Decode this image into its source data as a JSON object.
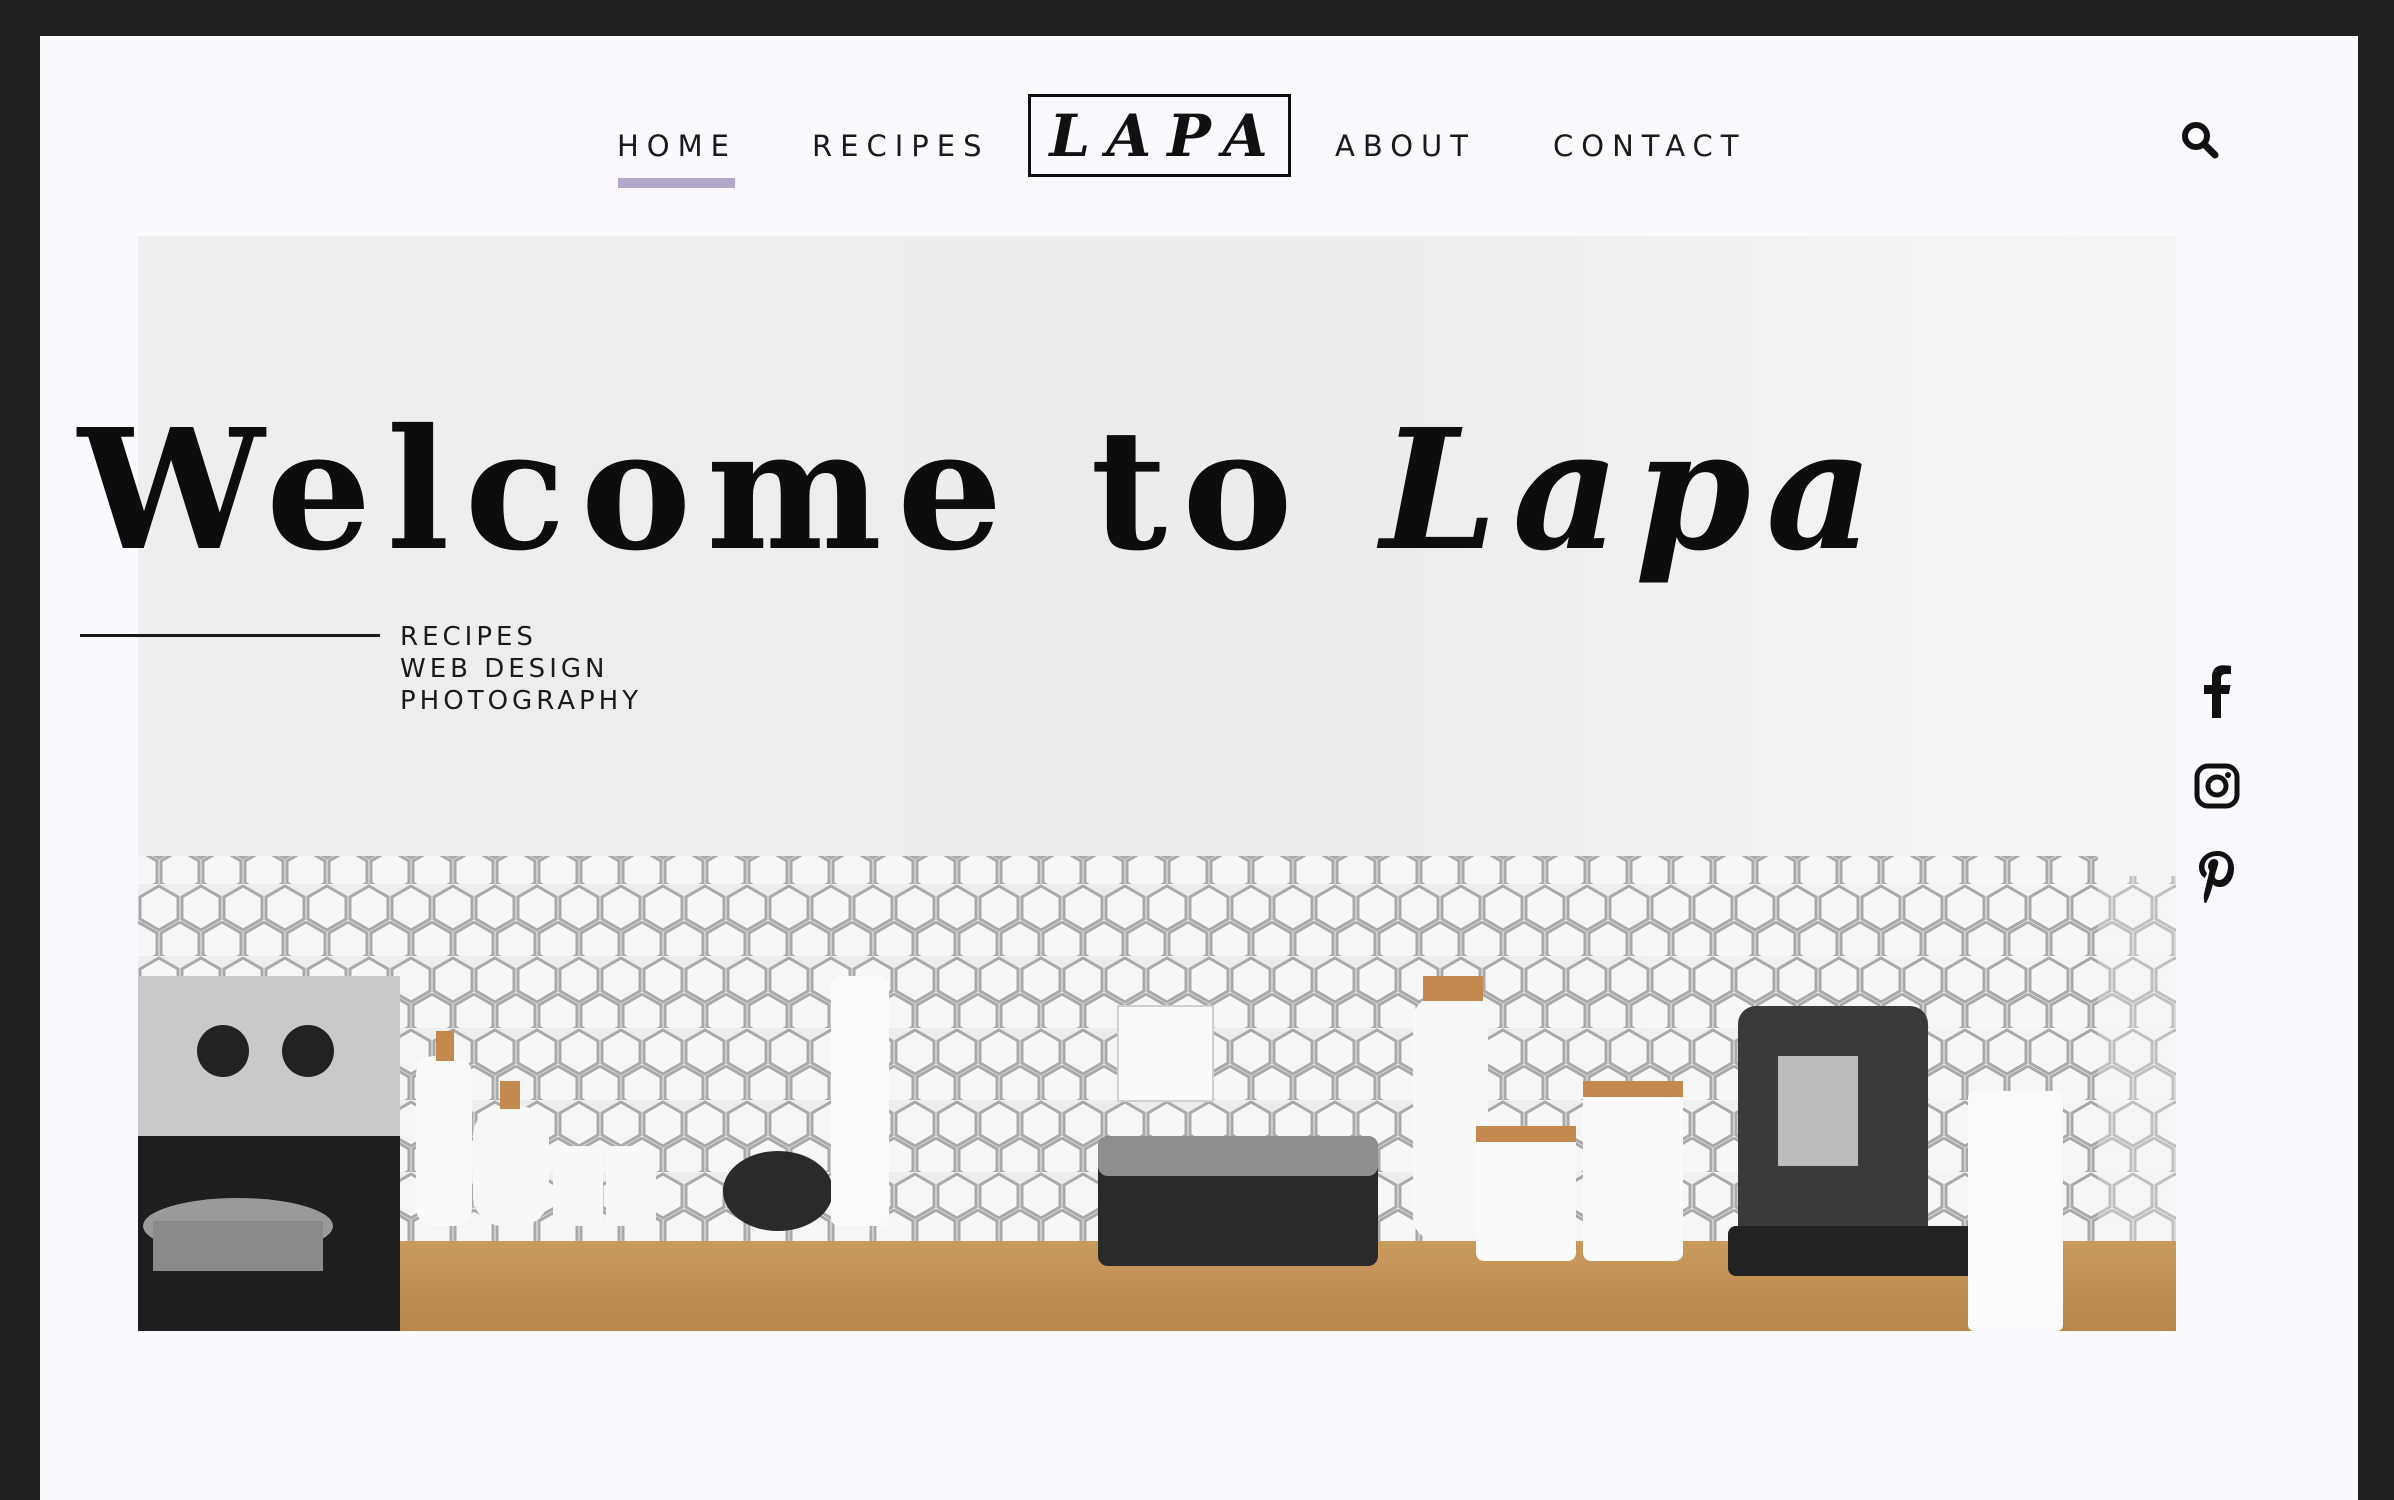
{
  "nav": {
    "home": "HOME",
    "recipes": "RECIPES",
    "logo": "LAPA",
    "about": "ABOUT",
    "contact": "CONTACT",
    "search_icon": "search-icon"
  },
  "hero": {
    "title_prefix": "Welcome to ",
    "title_brand": "Lapa",
    "image": "kitchen-counter-photo",
    "taglines": [
      "RECIPES",
      "WEB DESIGN",
      "PHOTOGRAPHY"
    ]
  },
  "social": {
    "icons": [
      "facebook-icon",
      "instagram-icon",
      "pinterest-icon"
    ]
  },
  "colors": {
    "background": "#fbf9fe",
    "frame": "#202020",
    "accent_underline": "#b2a8ce",
    "text": "#1a1a1a"
  }
}
